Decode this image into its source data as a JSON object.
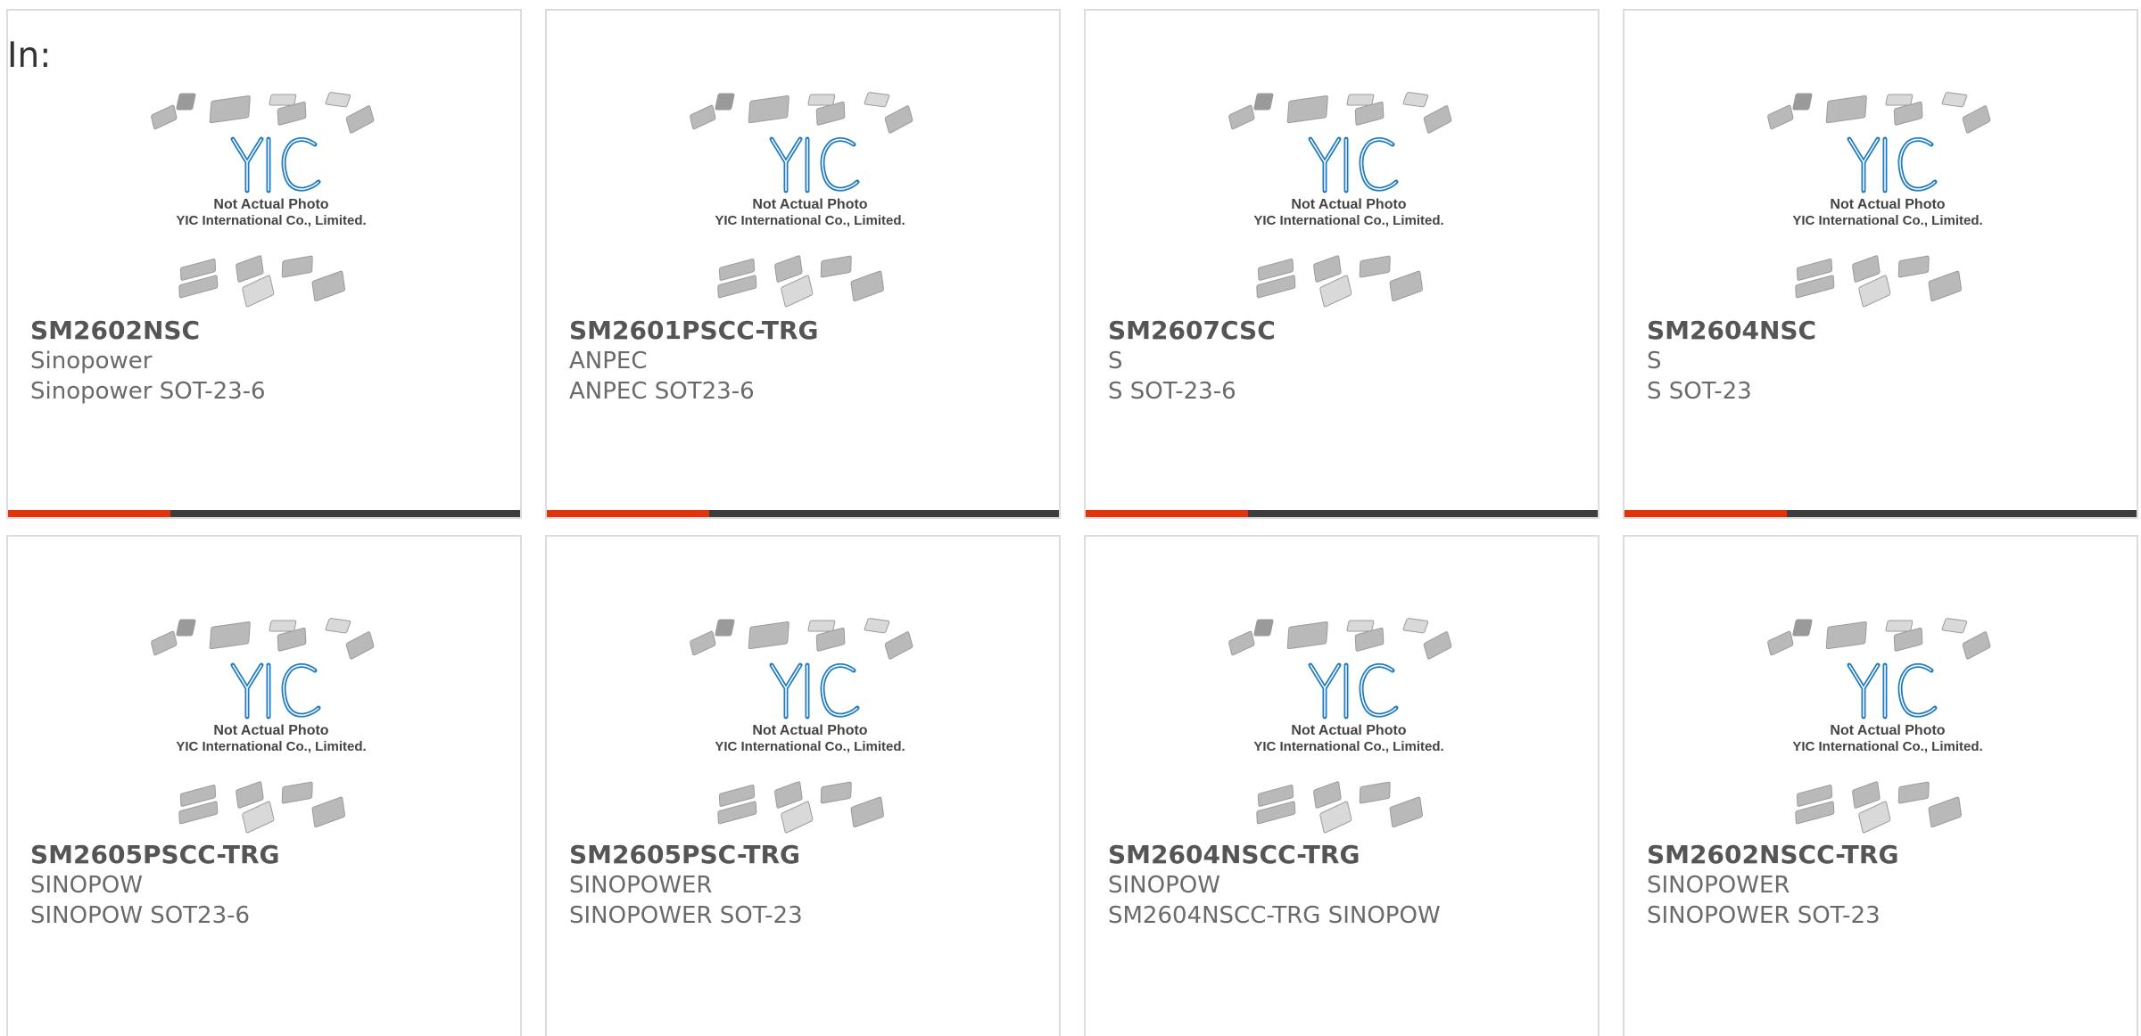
{
  "filter_label": "In:",
  "placeholder": {
    "logo_text": "YIC",
    "caption_line1": "Not Actual Photo",
    "caption_line2": "YIC International Co., Limited."
  },
  "colors": {
    "accent": "#e0340f",
    "bar": "#3d3d3d",
    "logo_blue": "#1f7bc2",
    "border": "#dcdcdc"
  },
  "products": [
    {
      "part": "SM2602NSC",
      "manufacturer": "Sinopower",
      "description": "Sinopower SOT-23-6"
    },
    {
      "part": "SM2601PSCC-TRG",
      "manufacturer": "ANPEC",
      "description": "ANPEC SOT23-6"
    },
    {
      "part": "SM2607CSC",
      "manufacturer": "S",
      "description": "S SOT-23-6"
    },
    {
      "part": "SM2604NSC",
      "manufacturer": "S",
      "description": "S SOT-23"
    },
    {
      "part": "SM2605PSCC-TRG",
      "manufacturer": "SINOPOW",
      "description": "SINOPOW SOT23-6"
    },
    {
      "part": "SM2605PSC-TRG",
      "manufacturer": "SINOPOWER",
      "description": "SINOPOWER SOT-23"
    },
    {
      "part": "SM2604NSCC-TRG",
      "manufacturer": "SINOPOW",
      "description": "SM2604NSCC-TRG SINOPOW"
    },
    {
      "part": "SM2602NSCC-TRG",
      "manufacturer": "SINOPOWER",
      "description": "SINOPOWER SOT-23"
    }
  ]
}
